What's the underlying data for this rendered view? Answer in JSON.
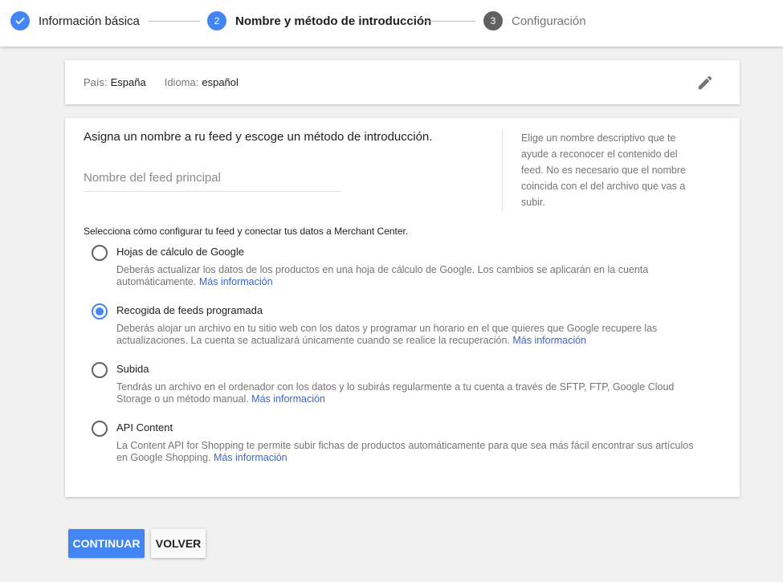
{
  "stepper": {
    "steps": [
      {
        "number": "",
        "label": "Información básica",
        "state": "completed"
      },
      {
        "number": "2",
        "label": "Nombre y método de introducción",
        "state": "active"
      },
      {
        "number": "3",
        "label": "Configuración",
        "state": "pending"
      }
    ]
  },
  "country_card": {
    "country_key": "País:",
    "country_value": "España",
    "language_key": "Idioma:",
    "language_value": "español",
    "edit_icon": "pencil-icon"
  },
  "main_card": {
    "title": "Asigna un nombre a ru feed y escoge un método de introducción.",
    "feed_name": {
      "value": "",
      "placeholder": "Nombre del feed principal"
    },
    "help_text": "Elige un nombre descriptivo que te ayude a reconocer el contenido del feed. No es necesario que el nombre coincida con el del archivo que vas a subir.",
    "method_prompt": "Selecciona cómo configurar tu feed y conectar tus datos a Merchant Center.",
    "options": [
      {
        "label": "Hojas de cálculo de Google",
        "description": "Deberás actualizar los datos de los productos en una hoja de cálculo de Google. Los cambios se aplicarán en la cuenta automáticamente.",
        "link": "Más información",
        "selected": false
      },
      {
        "label": "Recogida de feeds programada",
        "description": "Deberás alojar un archivo en tu sitio web con los datos y programar un horario en el que quieres que Google recupere las actualizaciones. La cuenta se actualizará únicamente cuando se realice la recuperación.",
        "link": "Más información",
        "selected": true
      },
      {
        "label": "Subida",
        "description": "Tendrás un archivo en el ordenador con los datos y lo subirás regularmente a tu cuenta a través de SFTP, FTP, Google Cloud Storage o un método manual.",
        "link": "Más información",
        "selected": false
      },
      {
        "label": "API Content",
        "description": "La Content API for Shopping te permite subir fichas de productos automáticamente para que sea más fácil encontrar sus artículos en Google Shopping.",
        "link": "Más información",
        "selected": false
      }
    ]
  },
  "buttons": {
    "continue_label": "CONTINUAR",
    "back_label": "VOLVER"
  },
  "colors": {
    "accent": "#4285f4",
    "link": "#3b66c4",
    "pending_step": "#616161"
  }
}
